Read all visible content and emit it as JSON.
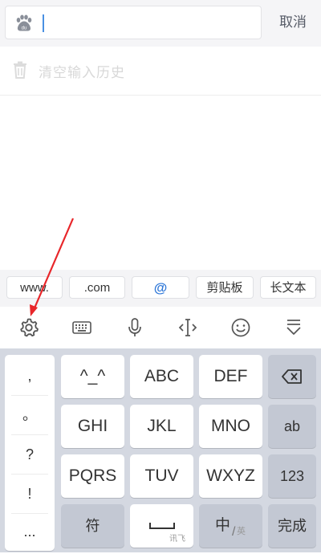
{
  "search": {
    "cancel_label": "取消",
    "icon": "baidu-paw-icon"
  },
  "history": {
    "clear_label": "清空输入历史",
    "icon": "trash-icon"
  },
  "quick_bar": {
    "items": [
      "www.",
      ".com",
      "@",
      "剪贴板",
      "长文本"
    ]
  },
  "toolbar": {
    "icons": [
      "gear-icon",
      "keyboard-icon",
      "microphone-icon",
      "cursor-move-icon",
      "emoji-icon",
      "hide-keyboard-icon"
    ]
  },
  "keyboard": {
    "punctuation": [
      ",",
      "。",
      "?",
      "!",
      "..."
    ],
    "row1": [
      "^_^",
      "ABC",
      "DEF"
    ],
    "row2": [
      "GHI",
      "JKL",
      "MNO"
    ],
    "row3": [
      "PQRS",
      "TUV",
      "WXYZ"
    ],
    "backspace_icon": "backspace-icon",
    "ab_label": "ab",
    "num_label": "123",
    "symbol_label": "符",
    "space_sub_label": "讯飞",
    "lang_label": "中",
    "lang_alt_label": "英",
    "done_label": "完成"
  },
  "annotation": {
    "color": "#e8262a",
    "points_to": "gear-icon"
  },
  "colors": {
    "accent_blue": "#2f78d8",
    "keyboard_bg": "#d4d8e1",
    "key_dark": "#c3c8d3"
  }
}
